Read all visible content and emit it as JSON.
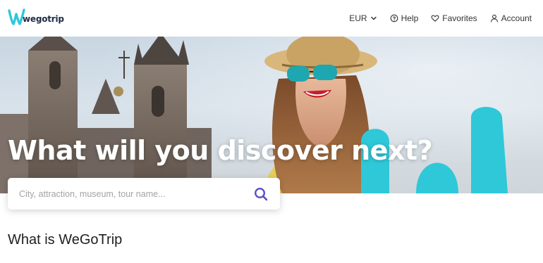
{
  "brand": {
    "name": "wegotrip"
  },
  "nav": {
    "currency": "EUR",
    "help": "Help",
    "favorites": "Favorites",
    "account": "Account"
  },
  "hero": {
    "title": "What will you discover next?"
  },
  "search": {
    "placeholder": "City, attraction, museum, tour name..."
  },
  "section": {
    "title": "What is WeGoTrip"
  },
  "colors": {
    "brand_teal": "#2ec8d8",
    "accent_purple": "#5a4fc4"
  },
  "icons": {
    "currency_dropdown": "chevron-down-icon",
    "help": "help-circle-icon",
    "favorites": "heart-icon",
    "account": "user-icon",
    "search": "search-icon"
  }
}
